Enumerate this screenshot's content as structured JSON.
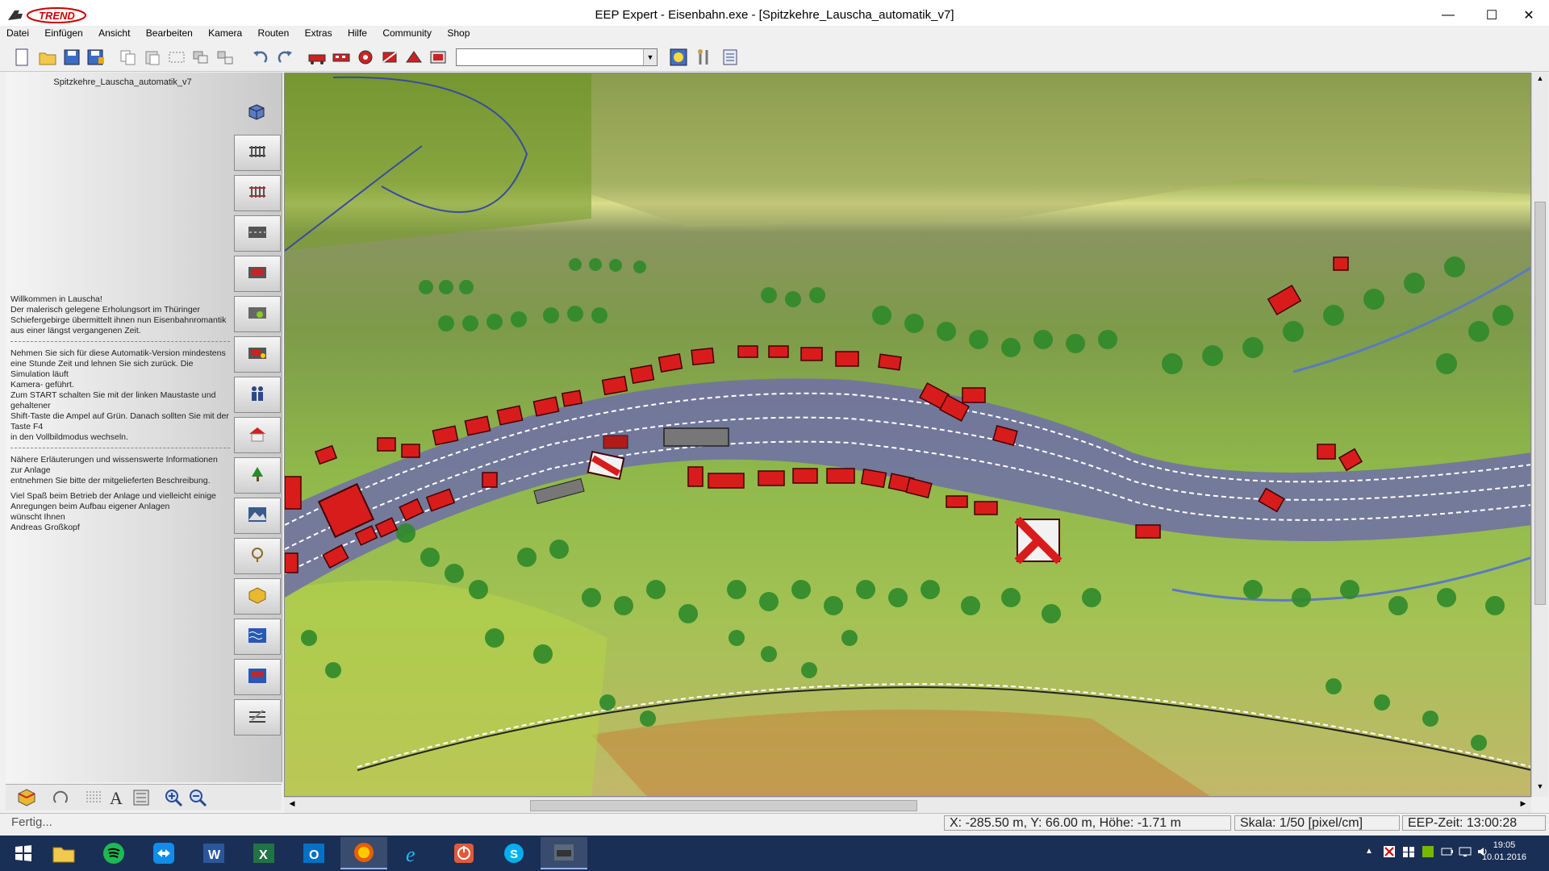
{
  "app": {
    "title": "EEP Expert - Eisenbahn.exe - [Spitzkehre_Lauscha_automatik_v7]",
    "logo_text": "TREND"
  },
  "menu": [
    "Datei",
    "Einfügen",
    "Ansicht",
    "Bearbeiten",
    "Kamera",
    "Routen",
    "Extras",
    "Hilfe",
    "Community",
    "Shop"
  ],
  "toolbar": {
    "layer_select_value": "",
    "icons": [
      "new-file-icon",
      "open-folder-icon",
      "save-icon",
      "save-as-icon",
      "copy-icon",
      "paste-icon",
      "select-icon",
      "group-icon",
      "ungroup-icon",
      "undo-icon",
      "redo-icon",
      "track-tool-1-icon",
      "track-tool-2-icon",
      "track-tool-3-icon",
      "track-tool-4-icon",
      "track-tool-5-icon",
      "track-tool-6-icon",
      "light-icon",
      "tools-icon",
      "properties-icon"
    ]
  },
  "left_panel": {
    "layout_name": "Spitzkehre_Lauscha_automatik_v7",
    "description_blocks": [
      "Willkommen in Lauscha!\nDer malerisch gelegene Erholungsort im Thüringer Schiefergebirge übermittelt ihnen nun Eisenbahnromantik\naus einer längst vergangenen Zeit.",
      "Nehmen Sie sich für diese Automatik-Version mindestens\neine Stunde Zeit und lehnen Sie sich zurück. Die Simulation läuft\nKamera- geführt.\nZum START schalten Sie mit der linken Maustaste und gehaltener\nShift-Taste die Ampel auf Grün. Danach sollten Sie mit der Taste F4\nin den Vollbildmodus wechseln.",
      "Nähere Erläuterungen und wissenswerte Informationen zur Anlage\nentnehmen Sie bitte der mitgelieferten Beschreibung.",
      "Viel Spaß beim Betrieb der Anlage und vielleicht einige Anregungen beim Aufbau eigener Anlagen\nwünscht Ihnen\nAndreas Großkopf"
    ],
    "category_buttons": [
      "rail-track-icon",
      "tram-track-icon",
      "road-icon",
      "road-vehicle-icon",
      "water-route-icon",
      "signal-icon",
      "people-icon",
      "building-icon",
      "tree-icon",
      "landscape-icon",
      "goods-icon",
      "cargo-icon",
      "water-icon",
      "water-vehicle-icon",
      "track-object-icon"
    ]
  },
  "status": {
    "text": "Fertig...",
    "coords": "X: -285.50 m, Y: 66.00 m, Höhe: -1.71 m",
    "scale": "Skala: 1/50 [pixel/cm]",
    "time": "EEP-Zeit: 13:00:28"
  },
  "taskbar": {
    "apps": [
      "windows-start-icon",
      "file-explorer-icon",
      "spotify-icon",
      "teamviewer-icon",
      "word-icon",
      "excel-icon",
      "outlook-icon",
      "firefox-icon",
      "internet-explorer-icon",
      "power-icon",
      "skype-icon",
      "eep-icon"
    ],
    "clock_time": "19:05",
    "clock_date": "10.01.2016"
  },
  "colors": {
    "accent": "#1a2f55",
    "house_red": "#d81c1c",
    "track_blue": "#6e6ea8",
    "grass_green": "#8fb84a"
  }
}
